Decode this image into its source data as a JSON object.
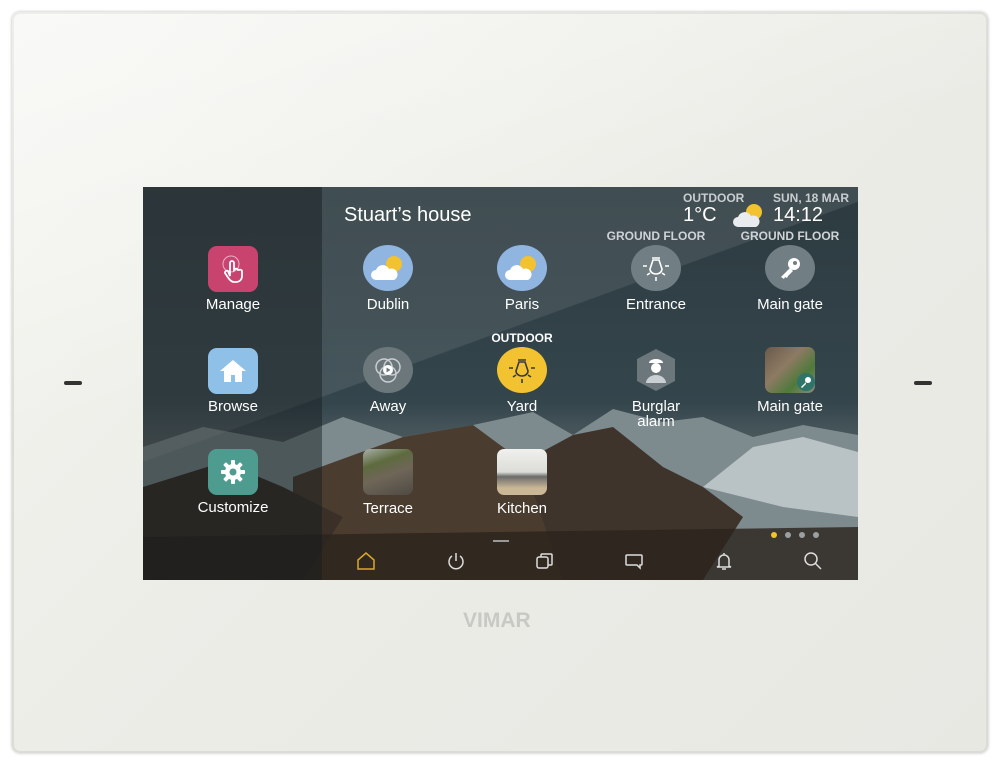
{
  "brand": "VIMAR",
  "house_title": "Stuart’s house",
  "header": {
    "outdoor_label": "OUTDOOR",
    "temperature": "1°C",
    "weather_icon": "partly-cloudy-icon",
    "date": "SUN, 18 MAR",
    "time": "14:12"
  },
  "sidebar": {
    "items": [
      {
        "label": "Manage",
        "icon": "touch-hand-icon",
        "color": "#c9436f"
      },
      {
        "label": "Browse",
        "icon": "house-icon",
        "color": "#8fc1e8"
      },
      {
        "label": "Customize",
        "icon": "gear-icon",
        "color": "#4e9c8f"
      }
    ]
  },
  "tiles": [
    {
      "label": "Dublin",
      "caption": "",
      "icon": "partly-cloudy-icon"
    },
    {
      "label": "Paris",
      "caption": "",
      "icon": "partly-cloudy-icon"
    },
    {
      "label": "Entrance",
      "caption": "GROUND FLOOR",
      "icon": "ceiling-light-icon"
    },
    {
      "label": "Main gate",
      "caption": "GROUND FLOOR",
      "icon": "key-icon"
    },
    {
      "label": "Away",
      "caption": "",
      "icon": "scenario-play-icon"
    },
    {
      "label": "Yard",
      "caption": "OUTDOOR",
      "icon": "ceiling-light-icon",
      "state": "on",
      "color": "#f2c230"
    },
    {
      "label": "Burglar alarm",
      "caption": "",
      "icon": "security-guard-icon"
    },
    {
      "label": "Main gate",
      "caption": "",
      "icon": "gate-photo-key-icon"
    },
    {
      "label": "Terrace",
      "caption": "",
      "icon": "terrace-photo"
    },
    {
      "label": "Kitchen",
      "caption": "",
      "icon": "kitchen-photo"
    }
  ],
  "pager": {
    "pages": 4,
    "current": 1,
    "active_color": "#f2c230"
  },
  "nav": [
    {
      "icon": "home-icon",
      "active": true
    },
    {
      "icon": "power-icon"
    },
    {
      "icon": "pages-icon"
    },
    {
      "icon": "message-icon"
    },
    {
      "icon": "bell-icon"
    },
    {
      "icon": "search-icon"
    }
  ]
}
